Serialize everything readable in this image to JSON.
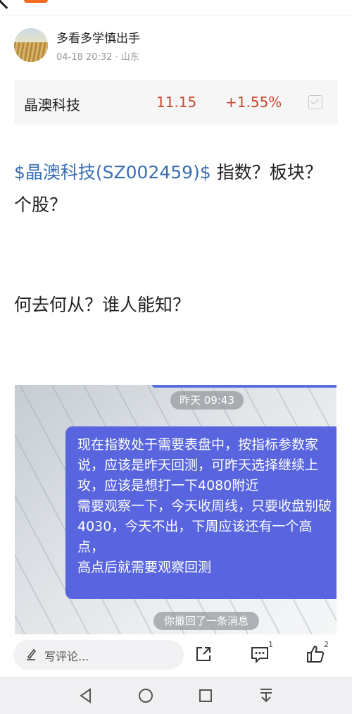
{
  "author": {
    "name": "多看多学慎出手",
    "time": "04-18 20:32",
    "location": "· 山东"
  },
  "stock": {
    "name": "晶澳科技",
    "price": "11.15",
    "change": "+1.55%",
    "change_color": "#c9472e"
  },
  "post": {
    "ticker": "$晶澳科技(SZ002459)$",
    "line1_rest": " 指数？板块？个股？",
    "line2": "何去何从？谁人能知？"
  },
  "screenshot": {
    "time_label": "昨天 09:43",
    "message": "现在指数处于需要表盘中，按指标参数家说，应该是昨天回测，可昨天选择继续上攻，应该是想打一下4080附近\n需要观察一下，今天收周线，只要收盘别破4030，今天不出，下周应该还有一个高点，\n高点后就需要观察回测",
    "recall_label": "你撤回了一条消息",
    "bubble_color": "#5865de"
  },
  "bottom": {
    "comment_placeholder": "写评论...",
    "comments_count": "1",
    "likes_count": "2"
  }
}
